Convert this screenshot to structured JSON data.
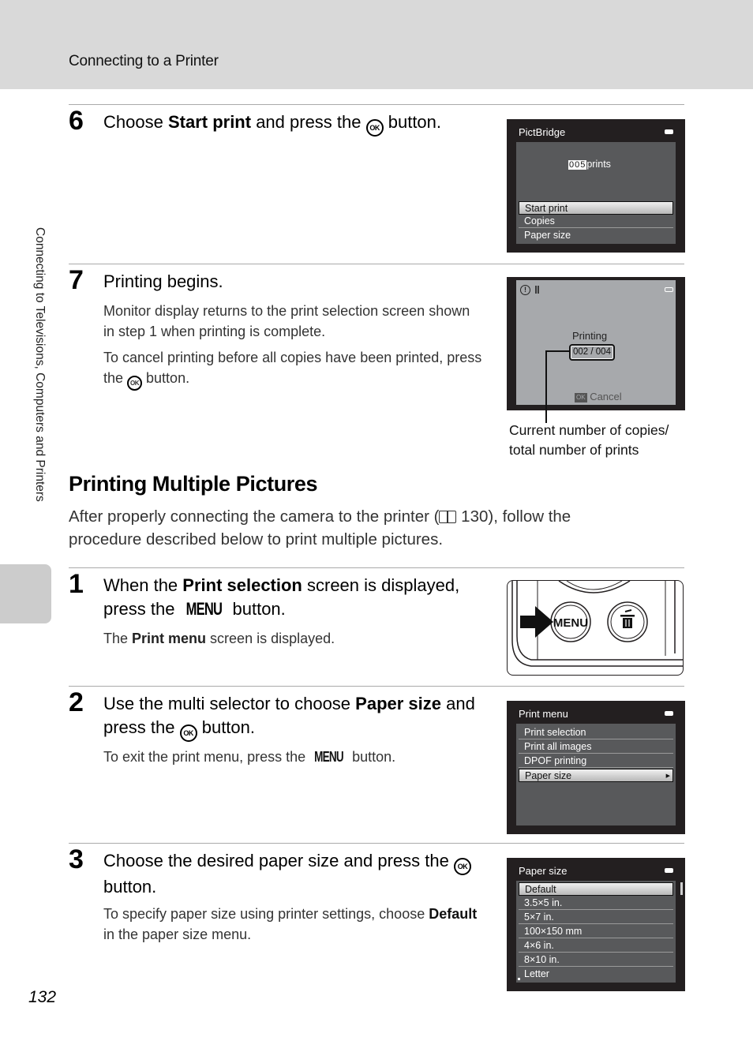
{
  "header": {
    "title": "Connecting to a Printer"
  },
  "side_label": "Connecting to Televisions, Computers and Printers",
  "page_number": "132",
  "step6": {
    "number": "6",
    "title_pre": "Choose ",
    "title_bold": "Start print",
    "title_mid": " and press the ",
    "ok_glyph": "OK",
    "title_post": " button.",
    "screen": {
      "title": "PictBridge",
      "count_value": "005",
      "count_label": "prints",
      "items": [
        "Start print",
        "Copies",
        "Paper size"
      ],
      "selected_index": 0
    }
  },
  "step7": {
    "number": "7",
    "title": "Printing begins.",
    "body1": "Monitor display returns to the print selection screen shown in step 1 when printing is complete.",
    "body2_pre": "To cancel printing before all copies have been printed, press the ",
    "ok_glyph": "OK",
    "body2_post": " button.",
    "screen": {
      "status_label": "Printing",
      "progress_text": "002 / 004",
      "progress_current": 2,
      "progress_total": 4,
      "cancel_key": "OK",
      "cancel_label": "Cancel"
    },
    "callout": {
      "line1": "Current number of copies/",
      "line2": "total number of prints"
    }
  },
  "section": {
    "title": "Printing Multiple Pictures",
    "intro_pre": "After properly connecting the camera to the printer (",
    "intro_ref": "130",
    "intro_post": "), follow the procedure described below to print multiple pictures."
  },
  "step1": {
    "number": "1",
    "title_pre": "When the ",
    "title_bold": "Print selection",
    "title_mid": " screen is displayed, press the ",
    "menu_glyph": "MENU",
    "title_post": " button.",
    "body_pre": "The ",
    "body_bold": "Print menu",
    "body_post": " screen is displayed.",
    "illustration": {
      "menu_button": "MENU",
      "delete_button": "delete-icon"
    }
  },
  "step2": {
    "number": "2",
    "title_pre": "Use the multi selector to choose ",
    "title_bold": "Paper size",
    "title_mid": " and press the ",
    "ok_glyph": "OK",
    "title_post": " button.",
    "body_pre": "To exit the print menu, press the ",
    "menu_glyph": "MENU",
    "body_post": " button.",
    "screen": {
      "title": "Print menu",
      "items": [
        "Print selection",
        "Print all images",
        "DPOF printing",
        "Paper size"
      ],
      "selected_index": 3
    }
  },
  "step3": {
    "number": "3",
    "title_pre": "Choose the desired paper size and press the ",
    "ok_glyph": "OK",
    "title_post": " button.",
    "body_pre": "To specify paper size using printer settings, choose ",
    "body_bold": "Default",
    "body_post": " in the paper size menu.",
    "screen": {
      "title": "Paper size",
      "items": [
        "Default",
        "3.5×5 in.",
        "5×7 in.",
        "100×150 mm",
        "4×6 in.",
        "8×10 in.",
        "Letter"
      ],
      "selected_index": 0
    }
  }
}
